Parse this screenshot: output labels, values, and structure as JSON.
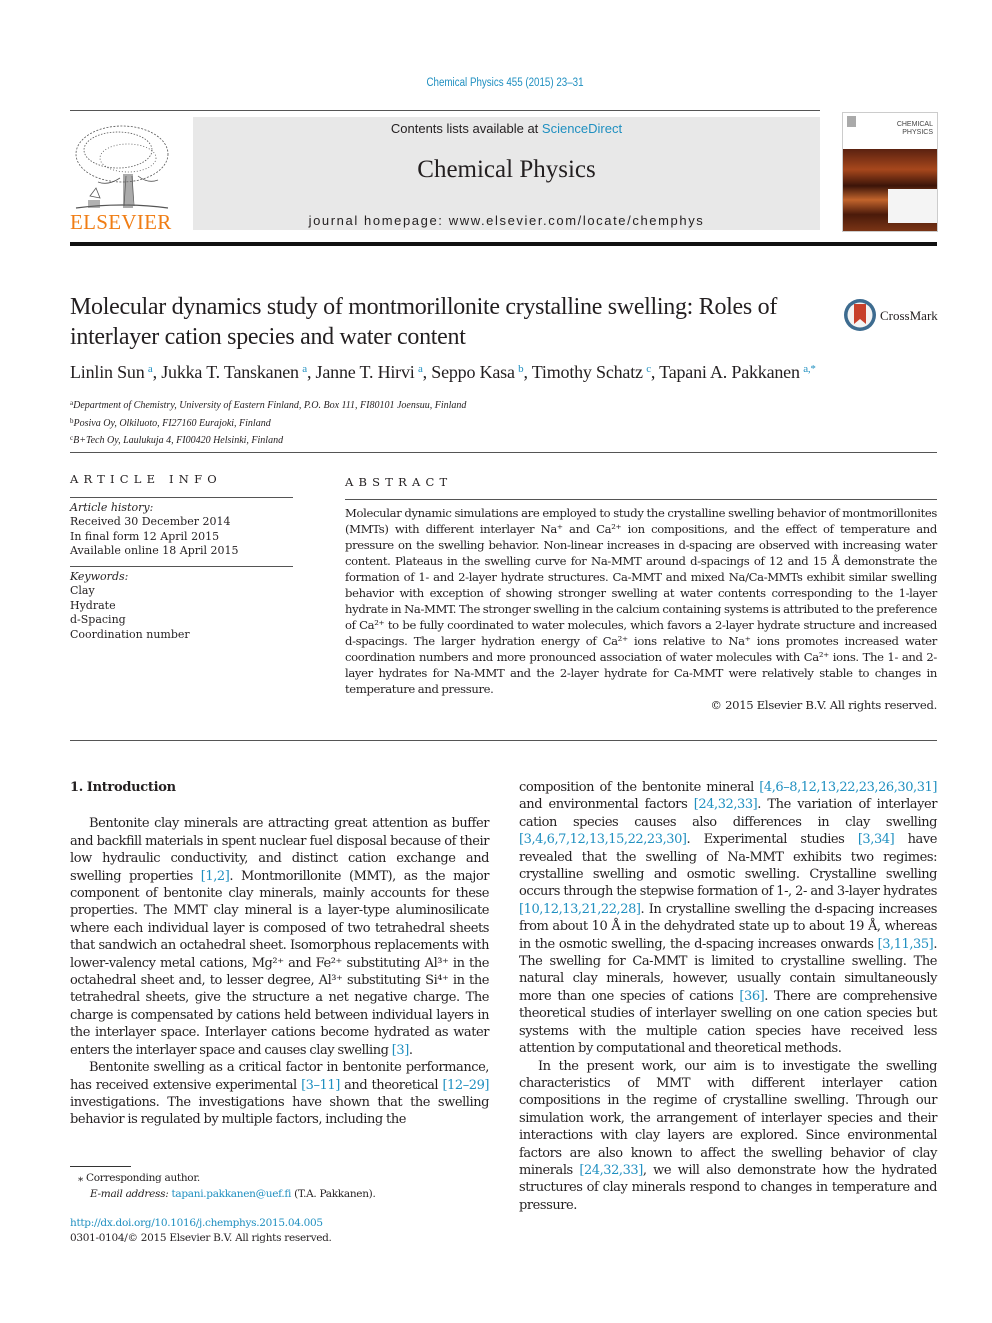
{
  "header": {
    "journal_reference": "Chemical Physics 455 (2015) 23–31",
    "contents_prefix": "Contents lists available at ",
    "contents_link": "ScienceDirect",
    "journal_title": "Chemical Physics",
    "homepage_prefix": "journal homepage: ",
    "homepage_url": "www.elsevier.com/locate/chemphys",
    "publisher_logo_text": "ELSEVIER",
    "cover_title_line1": "CHEMICAL",
    "cover_title_line2": "PHYSICS",
    "crossmark_label": "CrossMark"
  },
  "article": {
    "title": "Molecular dynamics study of montmorillonite crystalline swelling: Roles of interlayer cation species and water content",
    "authors": [
      {
        "name": "Linlin Sun",
        "aff": "a"
      },
      {
        "name": "Jukka T. Tanskanen",
        "aff": "a"
      },
      {
        "name": "Janne T. Hirvi",
        "aff": "a"
      },
      {
        "name": "Seppo Kasa",
        "aff": "b"
      },
      {
        "name": "Timothy Schatz",
        "aff": "c"
      },
      {
        "name": "Tapani A. Pakkanen",
        "aff": "a,*"
      }
    ],
    "affiliations": [
      {
        "mark": "a",
        "text": "Department of Chemistry, University of Eastern Finland, P.O. Box 111, FI80101 Joensuu, Finland"
      },
      {
        "mark": "b",
        "text": "Posiva Oy, Olkiluoto, FI27160 Eurajoki, Finland"
      },
      {
        "mark": "c",
        "text": "B+Tech Oy, Laulukuja 4, FI00420 Helsinki, Finland"
      }
    ]
  },
  "article_info": {
    "heading": "ARTICLE INFO",
    "history_label": "Article history:",
    "history": [
      "Received 30 December 2014",
      "In final form 12 April 2015",
      "Available online 18 April 2015"
    ],
    "keywords_label": "Keywords:",
    "keywords": [
      "Clay",
      "Hydrate",
      "d-Spacing",
      "Coordination number"
    ]
  },
  "abstract": {
    "heading": "ABSTRACT",
    "text": "Molecular dynamic simulations are employed to study the crystalline swelling behavior of montmorillonites (MMTs) with different interlayer Na⁺ and Ca²⁺ ion compositions, and the effect of temperature and pressure on the swelling behavior. Non-linear increases in d-spacing are observed with increasing water content. Plateaus in the swelling curve for Na-MMT around d-spacings of 12 and 15 Å demonstrate the formation of 1- and 2-layer hydrate structures. Ca-MMT and mixed Na/Ca-MMTs exhibit similar swelling behavior with exception of showing stronger swelling at water contents corresponding to the 1-layer hydrate in Na-MMT. The stronger swelling in the calcium containing systems is attributed to the preference of Ca²⁺ to be fully coordinated to water molecules, which favors a 2-layer hydrate structure and increased d-spacings. The larger hydration energy of Ca²⁺ ions relative to Na⁺ ions promotes increased water coordination numbers and more pronounced association of water molecules with Ca²⁺ ions. The 1- and 2-layer hydrates for Na-MMT and the 2-layer hydrate for Ca-MMT were relatively stable to changes in temperature and pressure.",
    "copyright": "© 2015 Elsevier B.V. All rights reserved."
  },
  "body": {
    "section_heading": "1. Introduction",
    "left_p1": [
      {
        "t": "Bentonite clay minerals are attracting great attention as buffer and backfill materials in spent nuclear fuel disposal because of their low hydraulic conductivity, and distinct cation exchange and swelling properties "
      },
      {
        "ref": "[1,2]"
      },
      {
        "t": ". Montmorillonite (MMT), as the major component of bentonite clay minerals, mainly accounts for these properties. The MMT clay mineral is a layer-type aluminosilicate where each individual layer is composed of two tetrahedral sheets that sandwich an octahedral sheet. Isomorphous replacements with lower-valency metal cations, Mg²⁺ and Fe²⁺ substituting Al³⁺ in the octahedral sheet and, to lesser degree, Al³⁺ substituting Si⁴⁺ in the tetrahedral sheets, give the structure a net negative charge. The charge is compensated by cations held between individual layers in the interlayer space. Interlayer cations become hydrated as water enters the interlayer space and causes clay swelling "
      },
      {
        "ref": "[3]"
      },
      {
        "t": "."
      }
    ],
    "left_p2": [
      {
        "t": "Bentonite swelling as a critical factor in bentonite performance, has received extensive experimental "
      },
      {
        "ref": "[3–11]"
      },
      {
        "t": " and theoretical "
      },
      {
        "ref": "[12–29]"
      },
      {
        "t": " investigations. The investigations have shown that the swelling behavior is regulated by multiple factors, including the"
      }
    ],
    "right_p1": [
      {
        "t": "composition of the bentonite mineral "
      },
      {
        "ref": "[4,6–8,12,13,22,23,26,30,31]"
      },
      {
        "t": " and environmental factors "
      },
      {
        "ref": "[24,32,33]"
      },
      {
        "t": ". The variation of interlayer cation species causes also differences in clay swelling "
      },
      {
        "ref": "[3,4,6,7,12,13,15,22,23,30]"
      },
      {
        "t": ". Experimental studies "
      },
      {
        "ref": "[3,34]"
      },
      {
        "t": " have revealed that the swelling of Na-MMT exhibits two regimes: crystalline swelling and osmotic swelling. Crystalline swelling occurs through the stepwise formation of 1-, 2- and 3-layer hydrates "
      },
      {
        "ref": "[10,12,13,21,22,28]"
      },
      {
        "t": ". In crystalline swelling the d-spacing increases from about 10 Å in the dehydrated state up to about 19 Å, whereas in the osmotic swelling, the d-spacing increases onwards "
      },
      {
        "ref": "[3,11,35]"
      },
      {
        "t": ". The swelling for Ca-MMT is limited to crystalline swelling. The natural clay minerals, however, usually contain simultaneously more than one species of cations "
      },
      {
        "ref": "[36]"
      },
      {
        "t": ". There are comprehensive theoretical studies of interlayer swelling on one cation species but systems with the multiple cation species have received less attention by computational and theoretical methods."
      }
    ],
    "right_p2": [
      {
        "t": "In the present work, our aim is to investigate the swelling characteristics of MMT with different interlayer cation compositions in the regime of crystalline swelling. Through our simulation work, the arrangement of interlayer species and their interactions with clay layers are explored. Since environmental factors are also known to affect the swelling behavior of clay minerals "
      },
      {
        "ref": "[24,32,33]"
      },
      {
        "t": ", we will also demonstrate how the hydrated structures of clay minerals respond to changes in temperature and pressure."
      }
    ]
  },
  "footnote": {
    "star": "⁎",
    "corresponding": "Corresponding author.",
    "email_label": "E-mail address:",
    "email": "tapani.pakkanen@uef.fi",
    "email_suffix": " (T.A. Pakkanen)."
  },
  "footer": {
    "doi": "http://dx.doi.org/10.1016/j.chemphys.2015.04.005",
    "issn_copyright": "0301-0104/© 2015 Elsevier B.V. All rights reserved."
  },
  "colors": {
    "link": "#1f8fc0",
    "elsevier_orange": "#f07d14",
    "banner_gray": "#e8e8e8"
  }
}
